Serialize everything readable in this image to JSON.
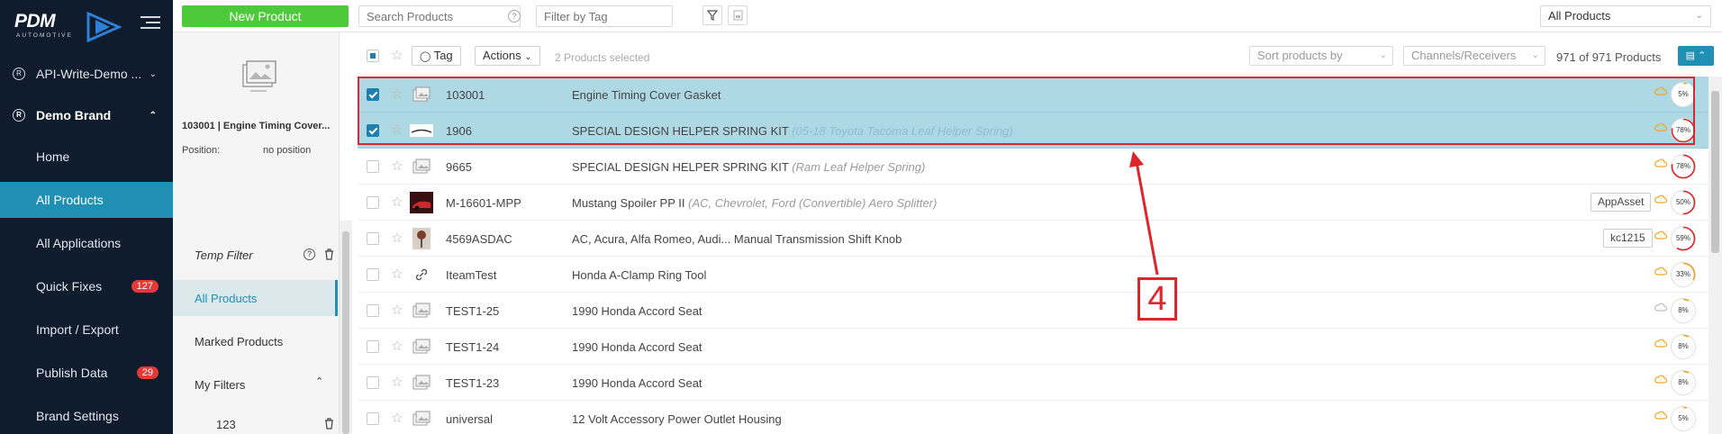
{
  "sidebar": {
    "logo_text": "PDM",
    "logo_sub": "AUTOMOTIVE",
    "accounts": [
      {
        "label": "API-Write-Demo ..."
      },
      {
        "label": "Demo Brand"
      }
    ],
    "items": [
      {
        "label": "Home"
      },
      {
        "label": "All Products",
        "active": true
      },
      {
        "label": "All Applications"
      },
      {
        "label": "Quick Fixes",
        "badge": "127"
      },
      {
        "label": "Import / Export"
      },
      {
        "label": "Publish Data",
        "badge": "29"
      },
      {
        "label": "Brand Settings"
      }
    ]
  },
  "topbar": {
    "new_product": "New Product",
    "search_placeholder": "Search Products",
    "search_help": "?",
    "tag_filter_placeholder": "Filter by Tag",
    "view_select": "All Products"
  },
  "left_panel": {
    "product_title": "103001 | Engine Timing Cover...",
    "position_label": "Position:",
    "position_value": "no position",
    "temp_filter": "Temp Filter",
    "help": "?",
    "all_products": "All Products",
    "marked_products": "Marked Products",
    "my_filters": "My Filters",
    "filters": [
      {
        "label": "123"
      }
    ]
  },
  "listbar": {
    "tag_button": "Tag",
    "actions_button": "Actions",
    "selected_text": "2 Products selected",
    "sort_placeholder": "Sort products by",
    "channels_placeholder": "Channels/Receivers",
    "count": "971 of 971 Products"
  },
  "rows": [
    {
      "sku": "103001",
      "name": "Engine Timing Cover Gasket",
      "desc": "",
      "tag": "",
      "pct": "5%",
      "pct_value": 5,
      "selected": true,
      "img": "placeholder"
    },
    {
      "sku": "1906",
      "name": "SPECIAL DESIGN HELPER SPRING KIT",
      "desc": "(05-18 Toyota Tacoma Leaf Helper Spring)",
      "tag": "",
      "pct": "78%",
      "pct_value": 78,
      "selected": true,
      "img": "spring"
    },
    {
      "sku": "9665",
      "name": "SPECIAL DESIGN HELPER SPRING KIT",
      "desc": "(Ram Leaf Helper Spring)",
      "tag": "",
      "pct": "78%",
      "pct_value": 78,
      "selected": false,
      "img": "placeholder"
    },
    {
      "sku": "M-16601-MPP",
      "name": "Mustang Spoiler PP II",
      "desc": "(AC, Chevrolet, Ford (Convertible) Aero Splitter)",
      "tag": "AppAsset",
      "pct": "50%",
      "pct_value": 50,
      "selected": false,
      "img": "car"
    },
    {
      "sku": "4569ASDAC",
      "name": "AC, Acura, Alfa Romeo, Audi... Manual Transmission Shift Knob",
      "desc": "",
      "tag": "kc1215",
      "pct": "59%",
      "pct_value": 59,
      "selected": false,
      "img": "knob"
    },
    {
      "sku": "IteamTest",
      "name": "Honda A-Clamp Ring Tool",
      "desc": "",
      "tag": "",
      "pct": "33%",
      "pct_value": 33,
      "selected": false,
      "img": "link"
    },
    {
      "sku": "TEST1-25",
      "name": "1990 Honda Accord Seat",
      "desc": "",
      "tag": "",
      "pct": "8%",
      "pct_value": 8,
      "selected": false,
      "img": "placeholder"
    },
    {
      "sku": "TEST1-24",
      "name": "1990 Honda Accord Seat",
      "desc": "",
      "tag": "",
      "pct": "8%",
      "pct_value": 8,
      "selected": false,
      "img": "placeholder"
    },
    {
      "sku": "TEST1-23",
      "name": "1990 Honda Accord Seat",
      "desc": "",
      "tag": "",
      "pct": "8%",
      "pct_value": 8,
      "selected": false,
      "img": "placeholder"
    },
    {
      "sku": "universal",
      "name": "12 Volt Accessory Power Outlet Housing",
      "desc": "",
      "tag": "",
      "pct": "5%",
      "pct_value": 5,
      "selected": false,
      "img": "placeholder"
    }
  ],
  "annotation": {
    "label": "4"
  },
  "colors": {
    "accent": "#1f8fb4",
    "green": "#4ec93b",
    "selected_row": "#aed9e4",
    "annotation": "#e0242a",
    "sidebar": "#0f1c2d"
  }
}
